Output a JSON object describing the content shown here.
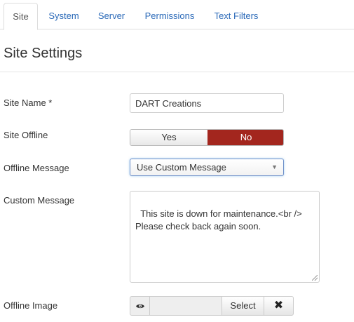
{
  "tabs": [
    {
      "label": "Site",
      "active": true
    },
    {
      "label": "System"
    },
    {
      "label": "Server"
    },
    {
      "label": "Permissions"
    },
    {
      "label": "Text Filters"
    }
  ],
  "section": {
    "title": "Site Settings"
  },
  "fields": {
    "site_name": {
      "label": "Site Name *",
      "value": "DART Creations"
    },
    "site_offline": {
      "label": "Site Offline",
      "yes_label": "Yes",
      "no_label": "No",
      "selected": "No"
    },
    "offline_message": {
      "label": "Offline Message",
      "value": "Use Custom Message"
    },
    "custom_message": {
      "label": "Custom Message",
      "value": "This site is down for maintenance.<br />\nPlease check back again soon."
    },
    "offline_image": {
      "label": "Offline Image",
      "preview_icon": "eye-icon",
      "select_label": "Select",
      "clear_icon": "close-icon"
    }
  },
  "colors": {
    "link": "#2a69b8",
    "toggle_active": "#a3261e",
    "focus_border": "#6d8fc9"
  }
}
